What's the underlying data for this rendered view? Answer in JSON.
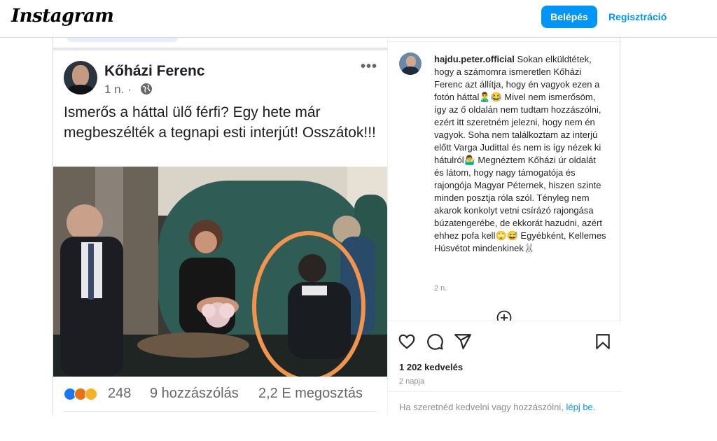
{
  "header": {
    "logo": "Instagram",
    "login_button": "Belépés",
    "register_link": "Regisztráció"
  },
  "embedded_post": {
    "author": "Kőházi Ferenc",
    "time": "1 n. ·",
    "more": "•••",
    "text": "Ismerős a háttal ülő férfi? Egy hete már megbeszélték a tegnapi esti interjút! Osszátok!!!",
    "reaction_count": "248",
    "comments": "9 hozzászólás",
    "shares": "2,2 E megosztás"
  },
  "caption": {
    "username": "hajdu.peter.official",
    "text": "Sokan elküldtétek, hogy a számomra ismeretlen Kőházi Ferenc azt állítja, hogy én vagyok ezen a fotón háttal🙎‍♂️😂 Mivel nem ismerősöm, így az ő oldalán nem tudtam hozzászólni, ezért itt szeretném jelezni, hogy nem én vagyok. Soha nem találkoztam az interjú előtt Varga Judittal és nem is így nézek ki hátulról🤷‍♂️ Megnéztem Kőházi úr oldalát és látom, hogy nagy támogatója és rajongója Magyar Péternek, hiszen szinte minden posztja róla szól. Tényleg nem akarok konkolyt vetni csírázó rajongása búzatengerébe, de ekkorát hazudni, azért ehhez pofa kell🙄😅 Egyébként, Kellemes Húsvétot mindenkinek🐰",
    "time": "2 n."
  },
  "stats": {
    "likes": "1 202 kedvelés",
    "age": "2 napja"
  },
  "footer": {
    "prompt": "Ha szeretnéd kedvelni vagy hozzászólni, ",
    "link": "lépj be."
  },
  "colors": {
    "accent": "#0095f6",
    "highlight_circle": "#f2944e",
    "sofa": "#2f5d55"
  },
  "icons": [
    "heart-icon",
    "comment-icon",
    "share-icon",
    "bookmark-icon",
    "plus-circle-icon",
    "globe-icon"
  ]
}
